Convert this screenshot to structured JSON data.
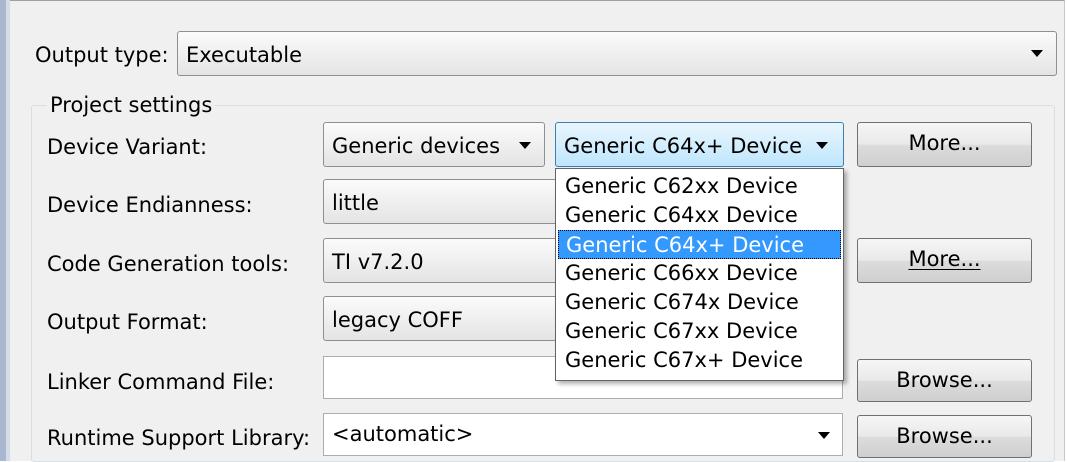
{
  "output_type": {
    "label": "Output type:",
    "value": "Executable"
  },
  "project_settings": {
    "title": "Project settings",
    "device_variant": {
      "label": "Device Variant:",
      "family": "Generic devices",
      "device": "Generic C64x+ Device",
      "more_label": "More..."
    },
    "endianness": {
      "label": "Device Endianness:",
      "value": "little"
    },
    "codegen": {
      "label": "Code Generation tools:",
      "value": "TI v7.2.0",
      "more_label": "More..."
    },
    "output_format": {
      "label": "Output Format:",
      "value": "legacy COFF"
    },
    "linker_cmd": {
      "label": "Linker Command File:",
      "value": "",
      "browse_label": "Browse..."
    },
    "rts_lib": {
      "label": "Runtime Support Library:",
      "value": "<automatic>",
      "browse_label": "Browse..."
    }
  },
  "device_dropdown": {
    "options": [
      "Generic C62xx Device",
      "Generic C64xx Device",
      "Generic C64x+ Device",
      "Generic C66xx Device",
      "Generic C674x Device",
      "Generic C67xx Device",
      "Generic C67x+ Device"
    ],
    "selected_index": 2
  },
  "colors": {
    "selection": "#3399ff",
    "panel": "#f0f0f0"
  }
}
